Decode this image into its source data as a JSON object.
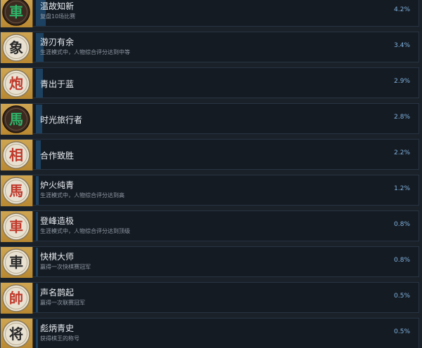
{
  "achievements": [
    {
      "title": "温故知新",
      "description": "复盘10场比赛",
      "percent": "4.2%",
      "progress": 4.2,
      "piece": "車",
      "piece_style": "dark",
      "char_color": "#2fb56a"
    },
    {
      "title": "游刃有余",
      "description": "生涯模式中，人物综合评分达到中等",
      "percent": "3.4%",
      "progress": 3.4,
      "piece": "象",
      "piece_style": "light",
      "char_color": "#2a2a2a"
    },
    {
      "title": "青出于蓝",
      "description": "",
      "percent": "2.9%",
      "progress": 2.9,
      "piece": "炮",
      "piece_style": "light",
      "char_color": "#c0392b"
    },
    {
      "title": "时光旅行者",
      "description": "",
      "percent": "2.8%",
      "progress": 2.8,
      "piece": "馬",
      "piece_style": "dark",
      "char_color": "#2fb56a"
    },
    {
      "title": "合作致胜",
      "description": "",
      "percent": "2.2%",
      "progress": 2.2,
      "piece": "相",
      "piece_style": "light",
      "char_color": "#c0392b"
    },
    {
      "title": "炉火纯青",
      "description": "生涯模式中，人物综合评分达到高",
      "percent": "1.2%",
      "progress": 1.2,
      "piece": "馬",
      "piece_style": "light",
      "char_color": "#c0392b"
    },
    {
      "title": "登峰造极",
      "description": "生涯模式中，人物综合评分达到顶级",
      "percent": "0.8%",
      "progress": 0.8,
      "piece": "車",
      "piece_style": "light",
      "char_color": "#c0392b"
    },
    {
      "title": "快棋大师",
      "description": "赢得一次快棋赛冠军",
      "percent": "0.8%",
      "progress": 0.8,
      "piece": "車",
      "piece_style": "light",
      "char_color": "#2a2a2a"
    },
    {
      "title": "声名鹊起",
      "description": "赢得一次联赛冠军",
      "percent": "0.5%",
      "progress": 0.5,
      "piece": "帥",
      "piece_style": "light",
      "char_color": "#c0392b"
    },
    {
      "title": "彪炳青史",
      "description": "获得棋王的称号",
      "percent": "0.5%",
      "progress": 0.5,
      "piece": "将",
      "piece_style": "light",
      "char_color": "#2a2a2a"
    }
  ]
}
